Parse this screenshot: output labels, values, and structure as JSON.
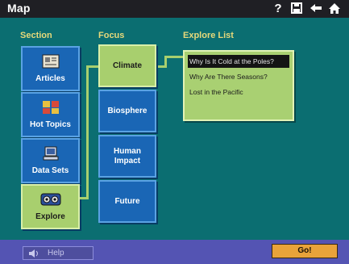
{
  "app": {
    "title": "Map"
  },
  "toolbar": {
    "help_glyph": "?",
    "icons": [
      "question-icon",
      "save-icon",
      "back-arrow-icon",
      "home-icon"
    ]
  },
  "columns": {
    "section": "Section",
    "focus": "Focus",
    "explore_list": "Explore List"
  },
  "section_items": [
    {
      "label": "Articles",
      "icon": "articles-icon",
      "selected": false
    },
    {
      "label": "Hot Topics",
      "icon": "hot-topics-icon",
      "selected": false
    },
    {
      "label": "Data Sets",
      "icon": "data-sets-icon",
      "selected": false
    },
    {
      "label": "Explore",
      "icon": "explore-icon",
      "selected": true
    }
  ],
  "focus_items": [
    {
      "label": "Climate",
      "selected": true
    },
    {
      "label": "Biosphere",
      "selected": false
    },
    {
      "label": "Human Impact",
      "selected": false
    },
    {
      "label": "Future",
      "selected": false
    }
  ],
  "explore_items": [
    {
      "label": "Why Is It Cold at the Poles?",
      "selected": true
    },
    {
      "label": "Why Are There Seasons?",
      "selected": false
    },
    {
      "label": "Lost in the Pacific",
      "selected": false
    }
  ],
  "bottom": {
    "help_label": "Help",
    "go_label": "Go!"
  },
  "colors": {
    "background": "#0b6e71",
    "tile_blue": "#1a66b5",
    "tile_selected": "#a8cf6e",
    "header_text": "#e7d97a",
    "bottom_bar": "#5454b3",
    "go_button": "#e9a33a"
  }
}
